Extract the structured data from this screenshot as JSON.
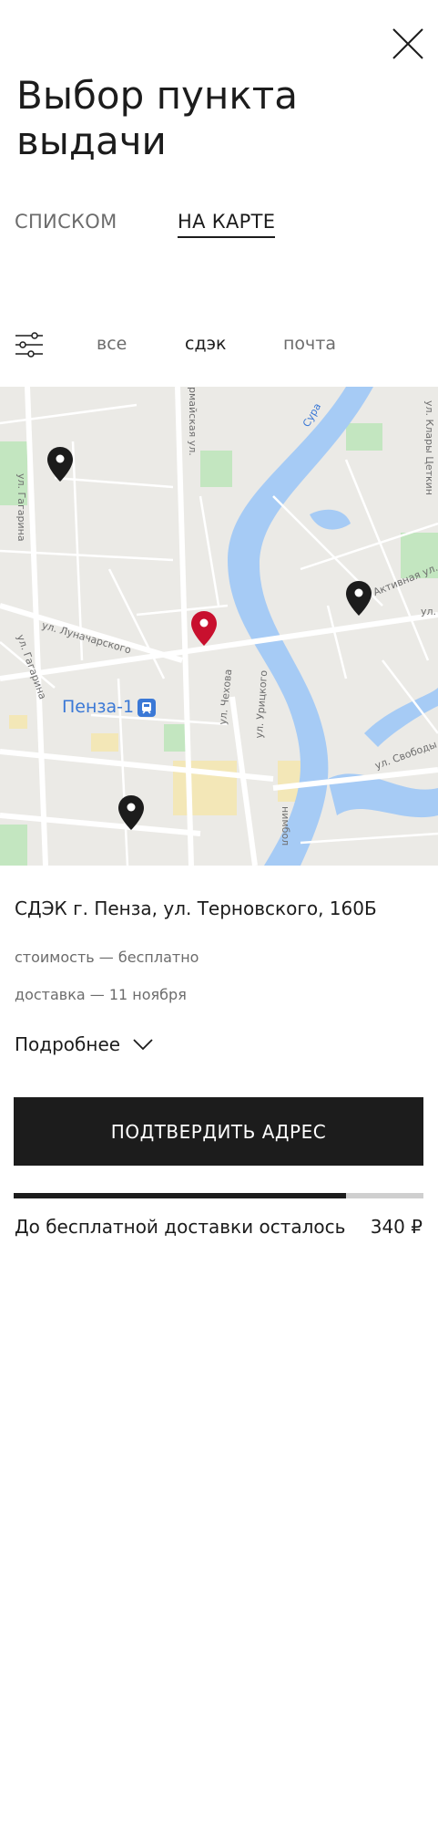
{
  "header": {
    "title": "Выбор пункта выдачи"
  },
  "view_tabs": {
    "list": "СПИСКОМ",
    "map": "НА КАРТЕ",
    "active": "map"
  },
  "filters": {
    "all": "все",
    "cdek": "сдэк",
    "post": "почта",
    "active": "cdek"
  },
  "map": {
    "station": "Пенза-1",
    "streets": {
      "gagarina_top": "ул. Гагарина",
      "gagarina_bottom": "ул. Гагарина",
      "lunacharskogo": "ул. Луначарского",
      "chekhova": "ул. Чехова",
      "uritskogo": "ул. Урицкого",
      "aktivnaya": "Активная ул.",
      "svobody": "ул. Свободы",
      "klary_tsetkin": "ул. Клары Цеткин",
      "ul_right": "ул.",
      "pervomayskaya": "рмайская ул.",
      "river": "Сура",
      "bottom_street": "нимбол"
    },
    "pin_colors": {
      "default": "#1c1c1c",
      "selected": "#c8102e"
    },
    "water_color": "#a6cbf5",
    "park_color": "#c3e6c0"
  },
  "pickup_point": {
    "address": "СДЭК г. Пенза, ул. Терновского, 160Б",
    "cost": "стоимость — бесплатно",
    "delivery": "доставка — 11 ноября",
    "details_label": "Подробнее"
  },
  "confirm_button": "ПОДТВЕРДИТЬ АДРЕС",
  "free_delivery": {
    "text": "До бесплатной доставки осталось",
    "amount": "340 ₽",
    "progress": 0.81
  }
}
